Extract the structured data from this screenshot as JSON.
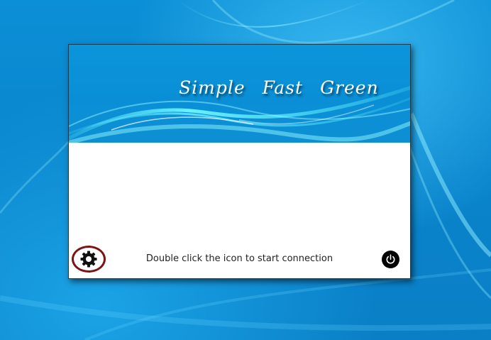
{
  "banner": {
    "slogan_words": [
      "Simple",
      "Fast",
      "Green"
    ]
  },
  "footer": {
    "status_text": "Double click the icon to start connection",
    "settings_icon": "gear-icon",
    "power_icon": "power-icon"
  },
  "colors": {
    "desktop_blue": "#0a8fd6",
    "banner_blue": "#0b95db",
    "settings_ring": "#7d1414",
    "power_button": "#000000"
  }
}
